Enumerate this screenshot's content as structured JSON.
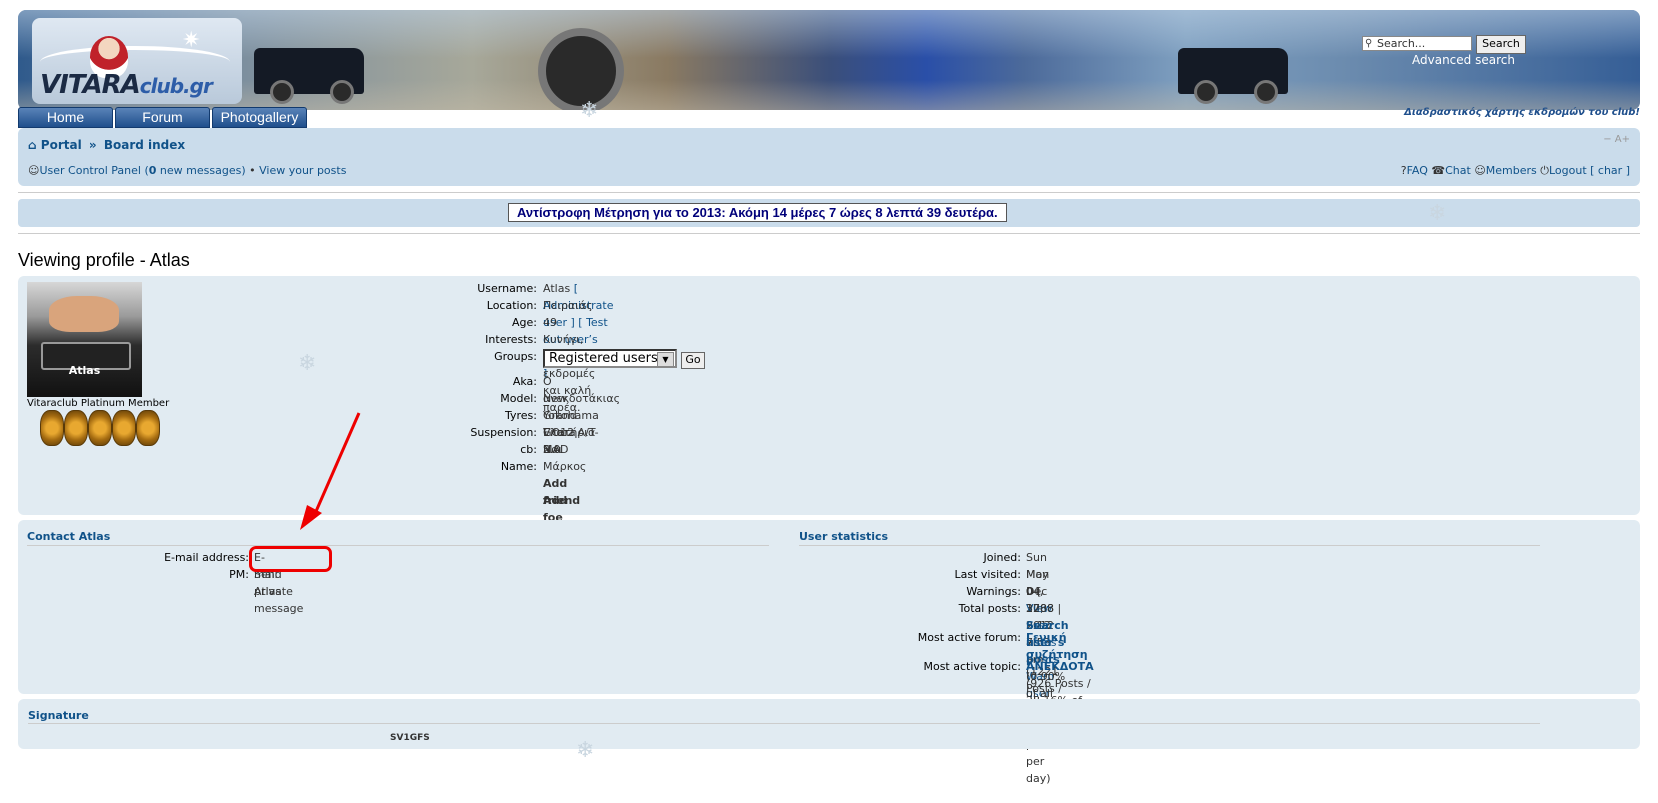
{
  "header": {
    "logo_text": "VITARA",
    "logo_suffix": "club.gr",
    "search_placeholder": "Search...",
    "search_button": "Search",
    "advanced_search": "Advanced search"
  },
  "nav": {
    "home": "Home",
    "forum": "Forum",
    "photogallery": "Photogallery",
    "map_link": "Διαδραστικός χάρτης εκδρομών του club!"
  },
  "breadcrumbs": {
    "portal": "Portal",
    "separator": "»",
    "board_index": "Board index",
    "resize": "− A+"
  },
  "user_bar": {
    "ucp_prefix": "User Control Panel (",
    "new_count": "0",
    "ucp_suffix": " new messages)",
    "bullet": "•",
    "view_posts": "View your posts",
    "faq": "FAQ",
    "chat": "Chat",
    "members": "Members",
    "logout": "Logout [ char ]"
  },
  "countdown": "Αντίστροφη Μέτρηση για το 2013: Ακόμη 14 μέρες 7 ώρες 8 λεπτά 39 δευτέρα.",
  "page_title": "Viewing profile - Atlas",
  "profile": {
    "avatar_caption": "Atlas",
    "rank": "Vitaraclub Platinum Member",
    "fields": {
      "username_label": "Username:",
      "username": "Atlas",
      "administrate": "[ Administrate user ]",
      "permissions": "[ Test out user’s permissions ]",
      "location_label": "Location:",
      "location": "Πειραιάς",
      "age_label": "Age:",
      "age": "49",
      "interests_label": "Interests:",
      "interests": "Κυνήγι, ψάρεμα , εκδρομές και καλή παρέα.",
      "groups_label": "Groups:",
      "groups_selected": "Registered users",
      "go": "Go",
      "aka_label": "Aka:",
      "aka": "Ο ανεκδοτάκιας",
      "model_label": "Model:",
      "model": "New Grand Vitara 2.0",
      "tyres_label": "Tyres:",
      "tyres": "Yokohama GO12 A/T-S",
      "suspension_label": "Suspension:",
      "suspension": "Ελατήρια MAD",
      "cb_label": "cb:",
      "cb": "Ναι",
      "name_label": "Name:",
      "name": "Μάρκος",
      "add_friend": "Add friend",
      "add_foe": "Add foe"
    }
  },
  "contact": {
    "heading": "Contact Atlas",
    "email_label": "E-mail address:",
    "email_link": "E-mail Atlas",
    "pm_label": "PM:",
    "pm_link": "Send private message"
  },
  "stats": {
    "heading": "User statistics",
    "joined_label": "Joined:",
    "joined": "Sun May 04, 2008 9:12 am",
    "last_label": "Last visited:",
    "last": "Mon Dec 17, 2012 7:53 am",
    "warnings_label": "Warnings:",
    "warnings": "0",
    "view_notes": "View user notes",
    "warn_user": "Warn user",
    "posts_label": "Total posts:",
    "posts": "3288",
    "search_posts": "Search user’s posts",
    "posts_detail": "(0.90% of all posts / 1.95 posts per day)",
    "forum_label": "Most active forum:",
    "forum": "Γενική συζήτηση",
    "forum_detail": "(1221 Posts / 37.14% of user’s posts)",
    "topic_label": "Most active topic:",
    "topic": "ΑΝΕΚΔΟΤΑ",
    "topic_detail": "(926 Posts / 28.16% of user’s posts)"
  },
  "signature": {
    "heading": "Signature",
    "text": "SV1GFS"
  },
  "colors": {
    "link": "#105289",
    "panel": "#e1ebf2",
    "bar": "#cadceb",
    "annotation": "#e00000"
  }
}
